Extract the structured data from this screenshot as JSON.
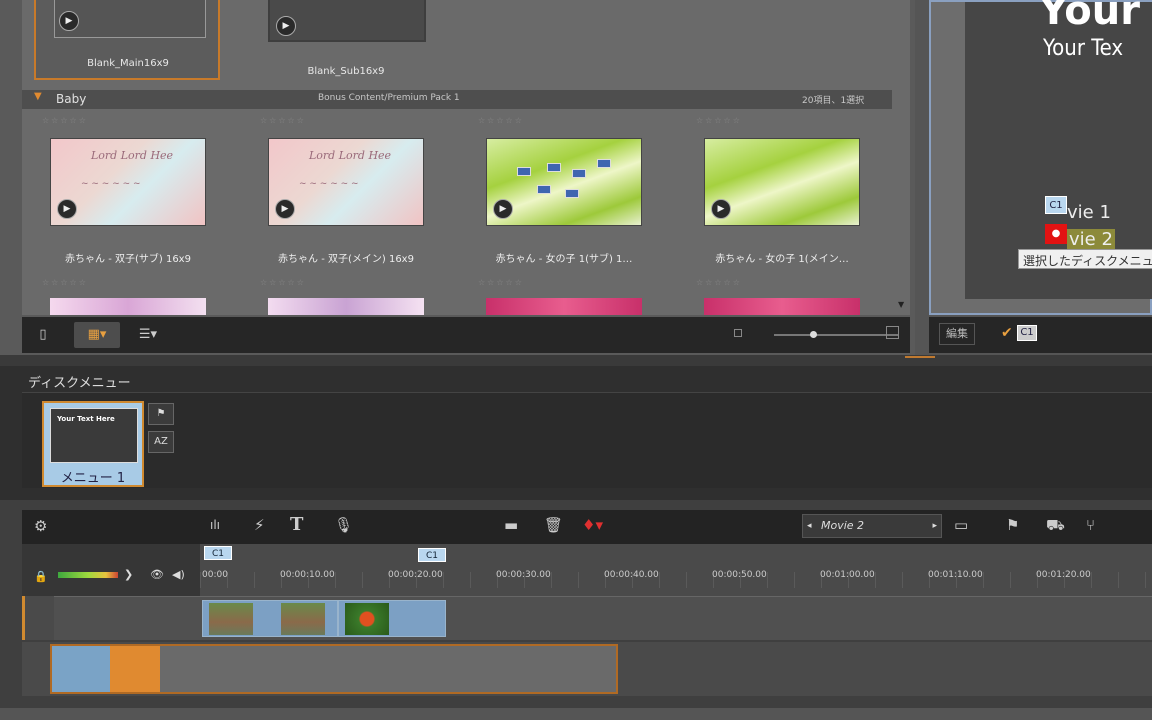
{
  "library": {
    "top_items": [
      {
        "label": "Blank_Main16x9"
      },
      {
        "label": "Blank_Sub16x9"
      }
    ],
    "category": {
      "name": "Baby",
      "path": "Bonus Content/Premium Pack 1",
      "count": "20項目、1選択"
    },
    "items": [
      {
        "caption": "赤ちゃん - 双子(サブ) 16x9",
        "style": "pink"
      },
      {
        "caption": "赤ちゃん - 双子(メイン) 16x9",
        "style": "pink"
      },
      {
        "caption": "赤ちゃん - 女の子 1(サブ) 1…",
        "style": "green"
      },
      {
        "caption": "赤ちゃん - 女の子 1(メイン…",
        "style": "green"
      }
    ]
  },
  "preview": {
    "title": "Your",
    "subtitle": "Your Tex",
    "movie1": "vie 1",
    "movie2": "vie 2",
    "chapter_badge": "C1",
    "tooltip": "選択したディスクメニュー",
    "edit_label": "編集",
    "toolbar_badge": "C1"
  },
  "disc_menu": {
    "label": "ディスクメニュー",
    "menu_name": "メニュー 1",
    "thumb_title": "Your Text Here",
    "side_btn_az": "AZ"
  },
  "timeline": {
    "movie_select": "Movie 2",
    "chapters": [
      "C1",
      "C1"
    ],
    "timecodes": [
      "00:00",
      "00:00:10.00",
      "00:00:20.00",
      "00:00:30.00",
      "00:00:40.00",
      "00:00:50.00",
      "00:01:00.00",
      "00:01:10.00",
      "00:01:20.00"
    ]
  }
}
